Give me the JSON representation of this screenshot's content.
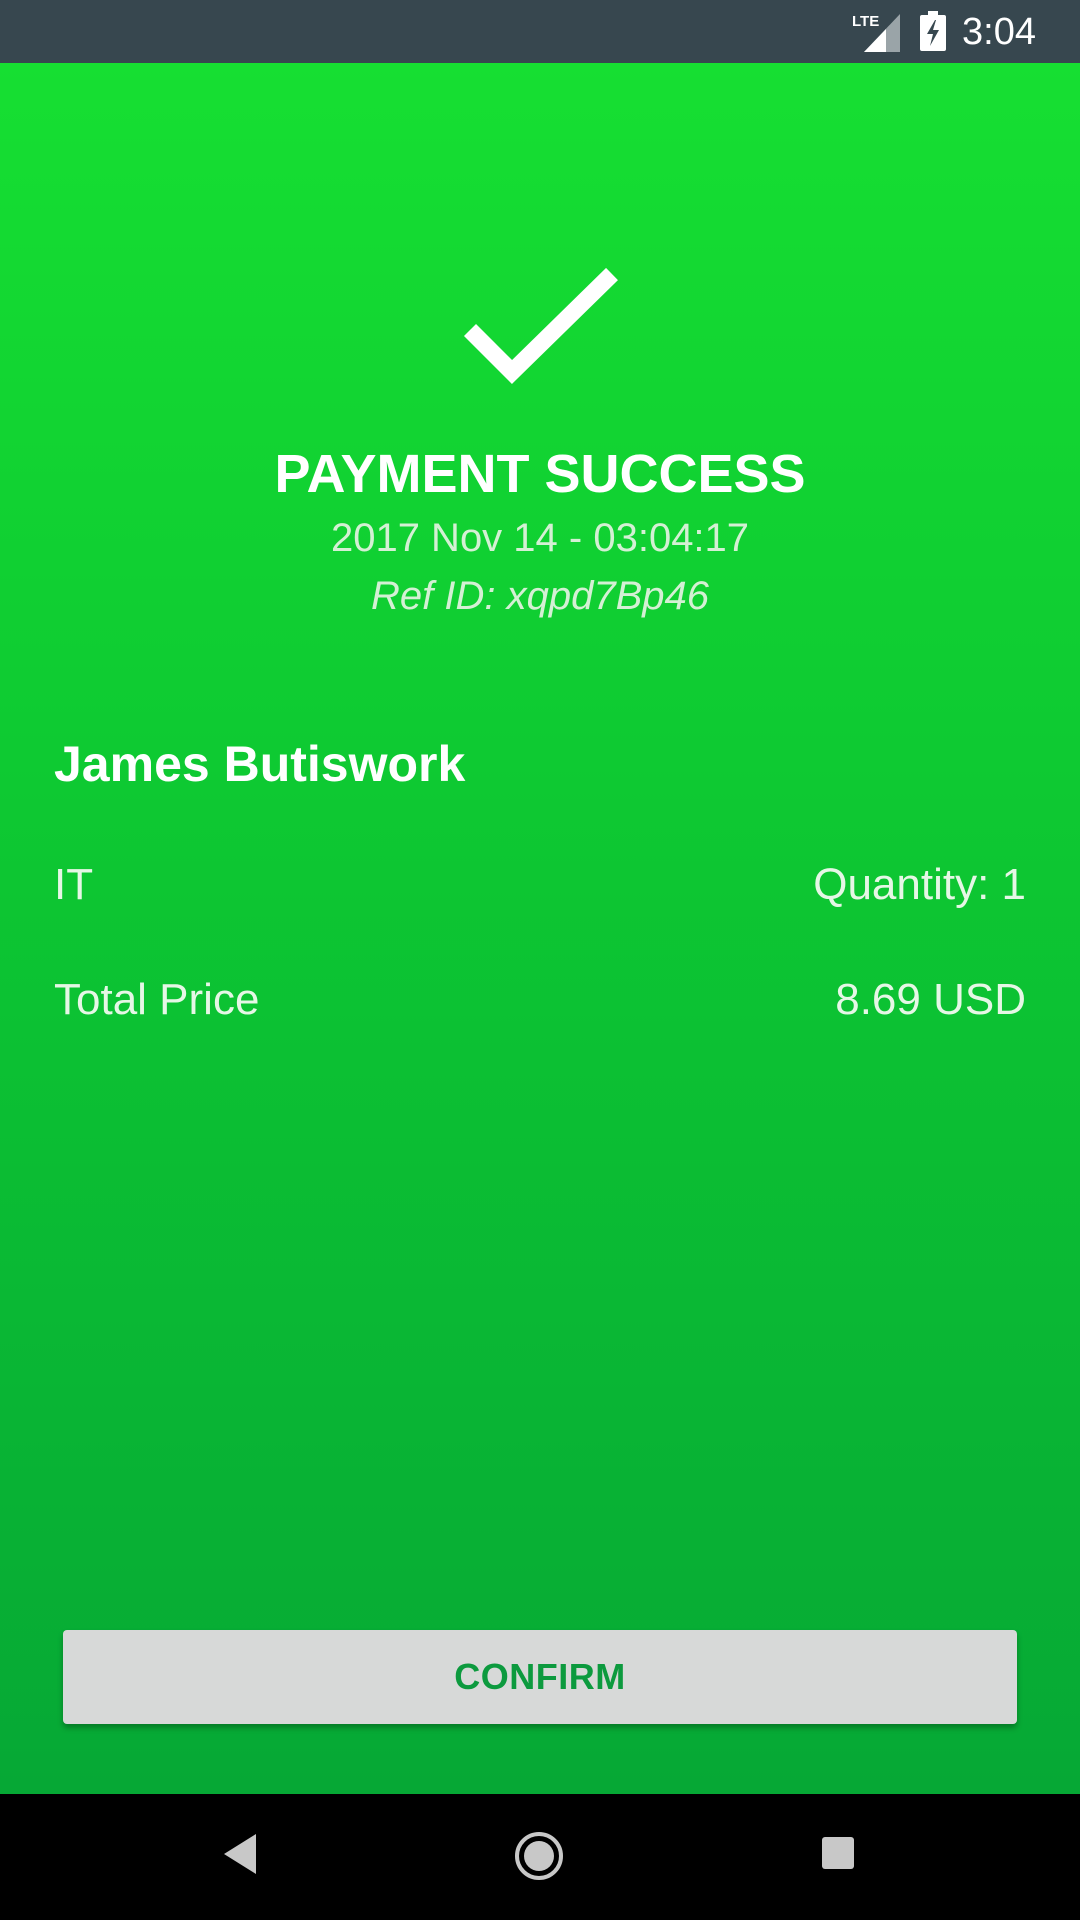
{
  "status_bar": {
    "time": "3:04",
    "network_label": "LTE",
    "icons": [
      "lte-signal-icon",
      "battery-charging-icon"
    ],
    "color": "#37474f"
  },
  "payment": {
    "icon": "checkmark-icon",
    "title": "PAYMENT SUCCESS",
    "datetime": "2017 Nov 14 - 03:04:17",
    "ref_id": "Ref ID: xqpd7Bp46",
    "customer_name": "James Butiswork",
    "item": {
      "name": "IT",
      "quantity_label": "Quantity: 1"
    },
    "total": {
      "label": "Total Price",
      "value": "8.69 USD"
    }
  },
  "actions": {
    "confirm_label": "CONFIRM"
  },
  "nav_bar": {
    "icons": [
      "back-icon",
      "home-icon",
      "recents-icon"
    ]
  },
  "colors": {
    "background_top": "#16df32",
    "background_bottom": "#06a835",
    "button_bg": "#d7d9d8",
    "button_text": "#0c9a3e"
  }
}
